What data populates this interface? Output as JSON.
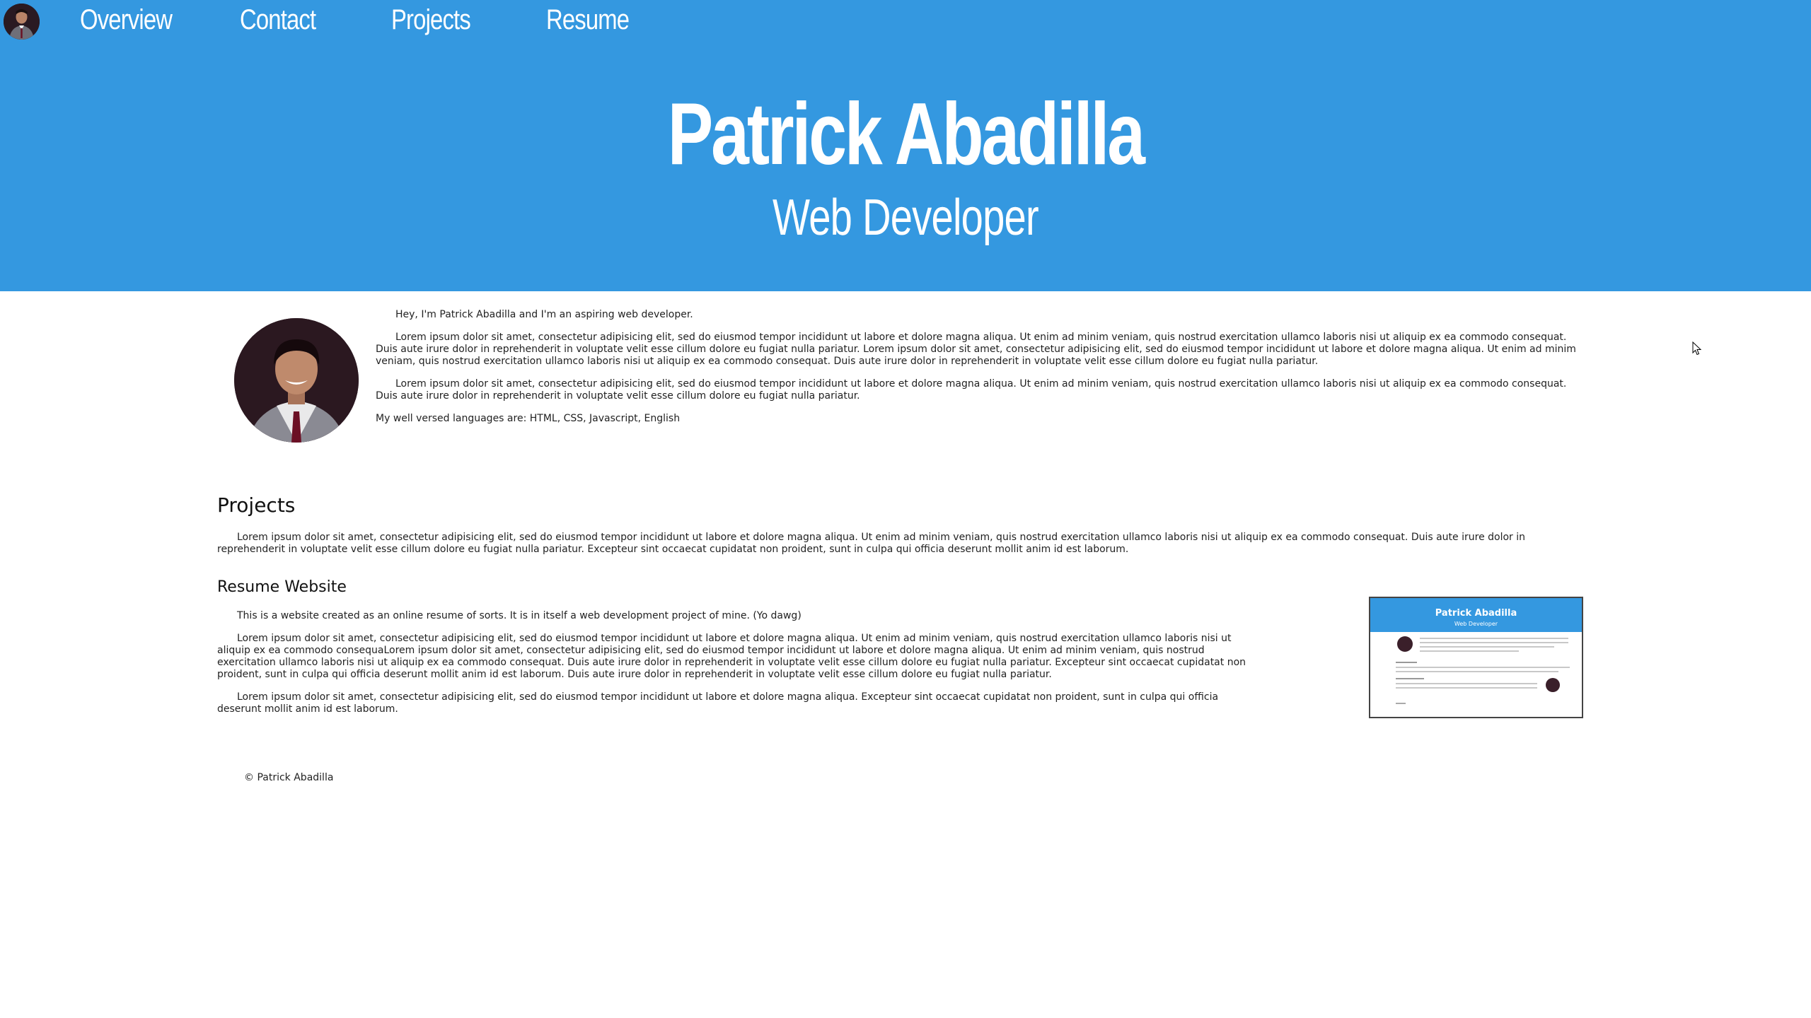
{
  "nav": {
    "links": [
      "Overview",
      "Contact",
      "Projects",
      "Resume"
    ]
  },
  "hero": {
    "name": "Patrick Abadilla",
    "title": "Web Developer"
  },
  "intro": {
    "greeting": "Hey, I'm Patrick Abadilla and I'm an aspiring web developer.",
    "para1": "Lorem ipsum dolor sit amet, consectetur adipisicing elit, sed do eiusmod tempor incididunt ut labore et dolore magna aliqua. Ut enim ad minim veniam, quis nostrud exercitation ullamco laboris nisi ut aliquip ex ea commodo consequat. Duis aute irure dolor in reprehenderit in voluptate velit esse cillum dolore eu fugiat nulla pariatur. Lorem ipsum dolor sit amet, consectetur adipisicing elit, sed do eiusmod tempor incididunt ut labore et dolore magna aliqua. Ut enim ad minim veniam, quis nostrud exercitation ullamco laboris nisi ut aliquip ex ea commodo consequat. Duis aute irure dolor in reprehenderit in voluptate velit esse cillum dolore eu fugiat nulla pariatur.",
    "para2": "Lorem ipsum dolor sit amet, consectetur adipisicing elit, sed do eiusmod tempor incididunt ut labore et dolore magna aliqua. Ut enim ad minim veniam, quis nostrud exercitation ullamco laboris nisi ut aliquip ex ea commodo consequat. Duis aute irure dolor in reprehenderit in voluptate velit esse cillum dolore eu fugiat nulla pariatur.",
    "languages": "My well versed languages are:  HTML,  CSS,  Javascript,  English"
  },
  "projects": {
    "heading": "Projects",
    "description": "Lorem ipsum dolor sit amet, consectetur adipisicing elit, sed do eiusmod tempor incididunt ut labore et dolore magna aliqua. Ut enim ad minim veniam, quis nostrud exercitation ullamco laboris nisi ut aliquip ex ea commodo consequat. Duis aute irure dolor in reprehenderit in voluptate velit esse cillum dolore eu fugiat nulla pariatur. Excepteur sint occaecat cupidatat non proident, sunt in culpa qui officia deserunt mollit anim id est laborum.",
    "items": [
      {
        "title": "Resume Website",
        "para1": "This is a website created as an online resume of sorts. It is in itself a web development project of mine. (Yo dawg)",
        "para2": "Lorem ipsum dolor sit amet, consectetur adipisicing elit, sed do eiusmod tempor incididunt ut labore et dolore magna aliqua. Ut enim ad minim veniam, quis nostrud exercitation ullamco laboris nisi ut aliquip ex ea commodo consequaLorem ipsum dolor sit amet, consectetur adipisicing elit, sed do eiusmod tempor incididunt ut labore et dolore magna aliqua. Ut enim ad minim veniam, quis nostrud exercitation ullamco laboris nisi ut aliquip ex ea commodo consequat. Duis aute irure dolor in reprehenderit in voluptate velit esse cillum dolore eu fugiat nulla pariatur. Excepteur sint occaecat cupidatat non proident, sunt in culpa qui officia deserunt mollit anim id est laborum. Duis aute irure dolor in reprehenderit in voluptate velit esse cillum dolore eu fugiat nulla pariatur.",
        "para3": "Lorem ipsum dolor sit amet, consectetur adipisicing elit, sed do eiusmod tempor incididunt ut labore et dolore magna aliqua. Excepteur sint occaecat cupidatat non proident, sunt in culpa qui officia deserunt mollit anim id est laborum.",
        "thumbnail": {
          "name": "Patrick Abadilla",
          "subtitle": "Web Developer"
        }
      }
    ]
  },
  "footer": {
    "copyright": "© Patrick Abadilla"
  },
  "colors": {
    "header_bg": "#3498e0",
    "header_text": "#ffffff"
  },
  "icons": {
    "nav_avatar": "avatar-icon",
    "cursor": "mouse-pointer-icon"
  }
}
